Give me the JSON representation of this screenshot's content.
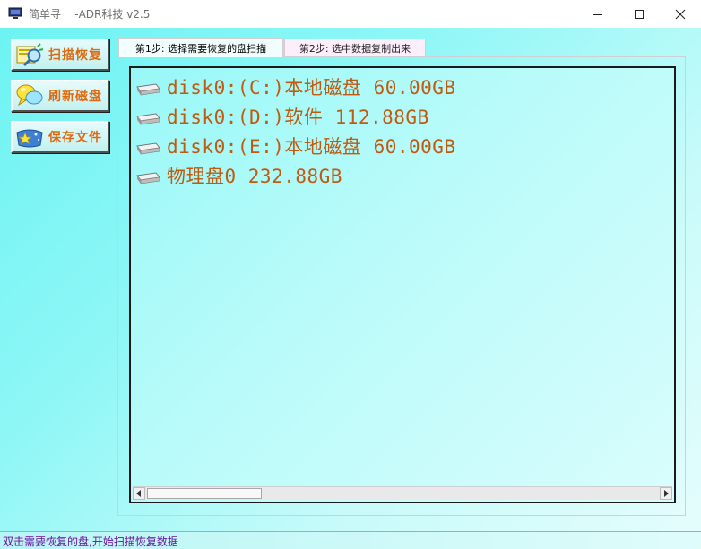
{
  "window": {
    "title": "简单寻    -ADR科技 v2.5",
    "controls": [
      "minimize-icon",
      "maximize-icon",
      "close-icon"
    ]
  },
  "sidebar": {
    "buttons": [
      {
        "label": "扫描恢复",
        "icon": "scan-magnifier-icon"
      },
      {
        "label": "刷新磁盘",
        "icon": "refresh-bubbles-icon"
      },
      {
        "label": "保存文件",
        "icon": "save-star-icon"
      }
    ]
  },
  "tabs": [
    {
      "label": "第1步: 选择需要恢复的盘扫描",
      "active": true
    },
    {
      "label": "第2步: 选中数据复制出来",
      "active": false
    }
  ],
  "disks": [
    {
      "text": "disk0:(C:)本地磁盘 60.00GB",
      "icon": "drive-icon"
    },
    {
      "text": "disk0:(D:)软件 112.88GB",
      "icon": "drive-icon"
    },
    {
      "text": "disk0:(E:)本地磁盘 60.00GB",
      "icon": "drive-icon"
    },
    {
      "text": "物理盘0 232.88GB",
      "icon": "drive-icon"
    }
  ],
  "scrollbar": {
    "left_arrow": "◂",
    "right_arrow": "▸"
  },
  "status": {
    "text": "双击需要恢复的盘,开始扫描恢复数据"
  },
  "colors": {
    "accent_text": "#c05a10",
    "button_label": "#e06a10",
    "status_text": "#6b10a0",
    "background": "#8ef7f6"
  }
}
